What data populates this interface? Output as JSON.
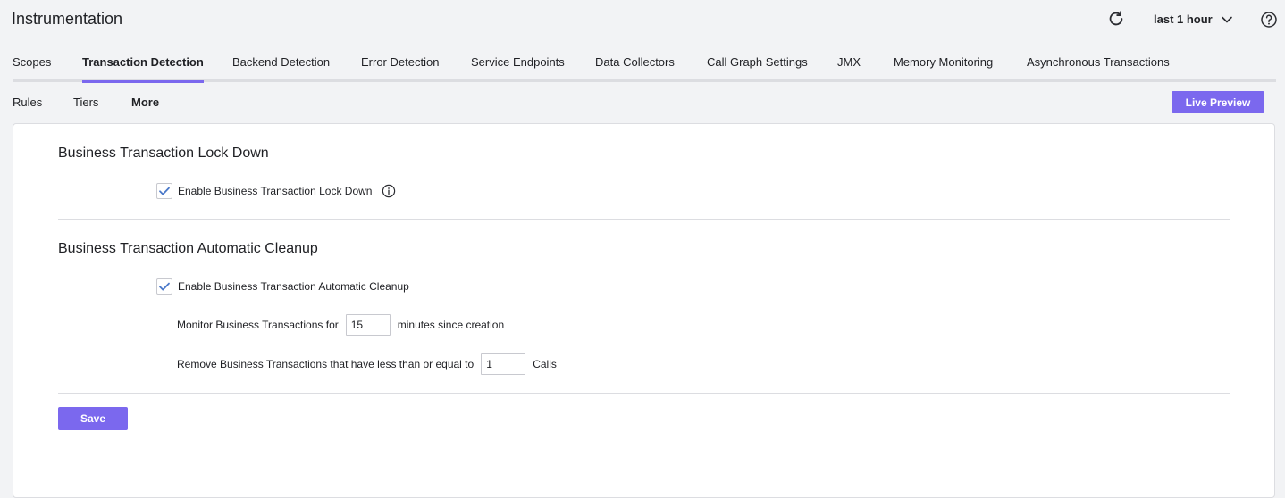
{
  "header": {
    "title": "Instrumentation",
    "time_range": "last 1 hour"
  },
  "tabs": [
    {
      "label": "Scopes"
    },
    {
      "label": "Transaction Detection"
    },
    {
      "label": "Backend Detection"
    },
    {
      "label": "Error Detection"
    },
    {
      "label": "Service Endpoints"
    },
    {
      "label": "Data Collectors"
    },
    {
      "label": "Call Graph Settings"
    },
    {
      "label": "JMX"
    },
    {
      "label": "Memory Monitoring"
    },
    {
      "label": "Asynchronous Transactions"
    }
  ],
  "active_tab": "Transaction Detection",
  "subnav": [
    {
      "label": "Rules"
    },
    {
      "label": "Tiers"
    },
    {
      "label": "More"
    }
  ],
  "live_preview_label": "Live Preview",
  "lockdown": {
    "title": "Business Transaction Lock Down",
    "checkbox_label": "Enable Business Transaction Lock Down",
    "checked": true
  },
  "cleanup": {
    "title": "Business Transaction Automatic Cleanup",
    "checkbox_label": "Enable Business Transaction Automatic Cleanup",
    "checked": true,
    "monitor_label": "Monitor Business Transactions for",
    "monitor_value": "15",
    "monitor_suffix": "minutes since creation",
    "remove_label": "Remove Business Transactions that have less than or equal to",
    "remove_value": "1",
    "remove_suffix": "Calls"
  },
  "save_label": "Save",
  "colors": {
    "accent": "#7b68ee",
    "check": "#4a78c9"
  }
}
